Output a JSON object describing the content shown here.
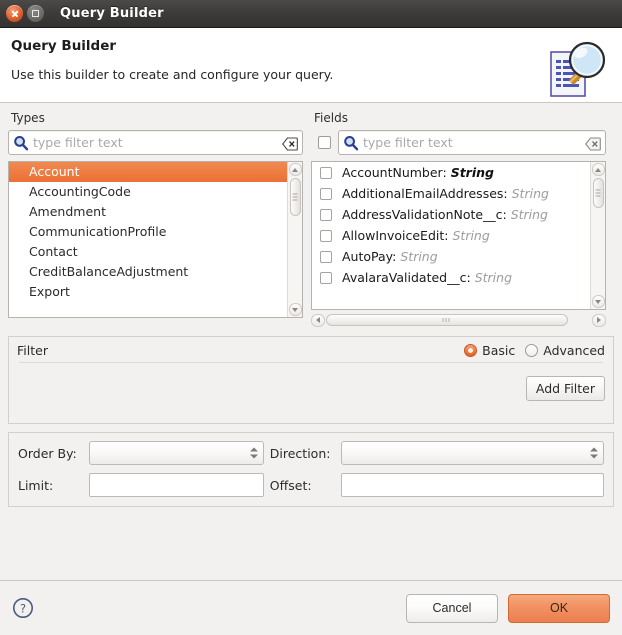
{
  "window": {
    "title": "Query Builder",
    "close_icon": "close-icon",
    "maximize_icon": "maximize-icon"
  },
  "header": {
    "title": "Query Builder",
    "subtitle": "Use this builder to create and configure your query.",
    "icon": "document-magnifier-icon"
  },
  "types": {
    "label": "Types",
    "search": {
      "placeholder": "type filter text",
      "value": "",
      "search_icon": "search-icon",
      "clear_icon": "clear-icon"
    },
    "items": [
      {
        "label": "Account",
        "selected": true
      },
      {
        "label": "AccountingCode",
        "selected": false
      },
      {
        "label": "Amendment",
        "selected": false
      },
      {
        "label": "CommunicationProfile",
        "selected": false
      },
      {
        "label": "Contact",
        "selected": false
      },
      {
        "label": "CreditBalanceAdjustment",
        "selected": false
      },
      {
        "label": "Export",
        "selected": false
      }
    ]
  },
  "fields": {
    "label": "Fields",
    "select_all_checked": false,
    "search": {
      "placeholder": "type filter text",
      "value": "",
      "search_icon": "search-icon",
      "clear_icon": "clear-icon"
    },
    "items": [
      {
        "name": "AccountNumber:",
        "type": "String",
        "checked": false,
        "current": true
      },
      {
        "name": "AdditionalEmailAddresses:",
        "type": "String",
        "checked": false,
        "current": false
      },
      {
        "name": "AddressValidationNote__c:",
        "type": "String",
        "checked": false,
        "current": false
      },
      {
        "name": "AllowInvoiceEdit:",
        "type": "String",
        "checked": false,
        "current": false
      },
      {
        "name": "AutoPay:",
        "type": "String",
        "checked": false,
        "current": false
      },
      {
        "name": "AvalaraValidated__c:",
        "type": "String",
        "checked": false,
        "current": false
      }
    ]
  },
  "filter": {
    "label": "Filter",
    "mode_basic": "Basic",
    "mode_advanced": "Advanced",
    "selected_mode": "Basic",
    "add_filter_label": "Add Filter"
  },
  "query_options": {
    "order_by_label": "Order By:",
    "order_by_value": "",
    "direction_label": "Direction:",
    "direction_value": "",
    "limit_label": "Limit:",
    "limit_value": "",
    "offset_label": "Offset:",
    "offset_value": ""
  },
  "footer": {
    "help_icon": "help-icon",
    "cancel_label": "Cancel",
    "ok_label": "OK"
  },
  "colors": {
    "accent": "#ec7034",
    "ok_button": "#f19163",
    "titlebar": "#3c3b39",
    "panel_bg": "#f2f1f0"
  }
}
